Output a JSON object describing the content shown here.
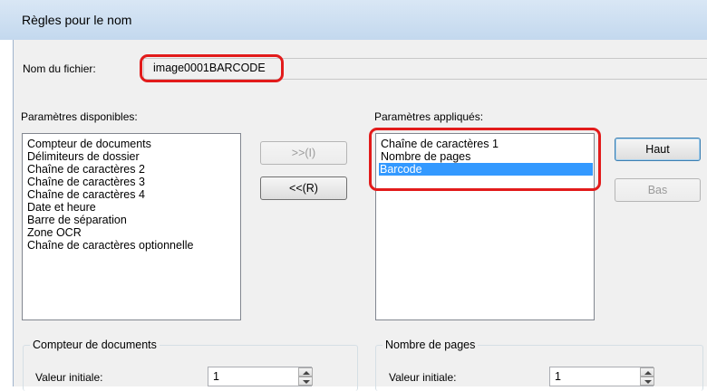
{
  "window": {
    "title": "Règles pour le nom"
  },
  "filename": {
    "label": "Nom du fichier:",
    "value": "image0001BARCODE"
  },
  "available": {
    "label": "Paramètres disponibles:",
    "items": [
      "Compteur de documents",
      "Délimiteurs de dossier",
      "Chaîne de caractères 2",
      "Chaîne de caractères 3",
      "Chaîne de caractères 4",
      "Date et heure",
      "Barre de séparation",
      "Zone OCR",
      "Chaîne de caractères optionnelle"
    ]
  },
  "buttons": {
    "add": ">>(I)",
    "remove": "<<(R)",
    "up": "Haut",
    "down": "Bas"
  },
  "applied": {
    "label": "Paramètres appliqués:",
    "items": [
      "Chaîne de caractères 1",
      "Nombre de pages",
      "Barcode"
    ],
    "selected_index": 2
  },
  "counter_group": {
    "title": "Compteur de documents",
    "initial_label": "Valeur initiale:",
    "initial_value": "1"
  },
  "pages_group": {
    "title": "Nombre de pages",
    "initial_label": "Valeur initiale:",
    "initial_value": "1"
  },
  "colors": {
    "highlight": "#e21b1b",
    "selection": "#3399ff"
  },
  "icons": {
    "spin_up": "spin-up-arrow-icon",
    "spin_down": "spin-down-arrow-icon"
  }
}
